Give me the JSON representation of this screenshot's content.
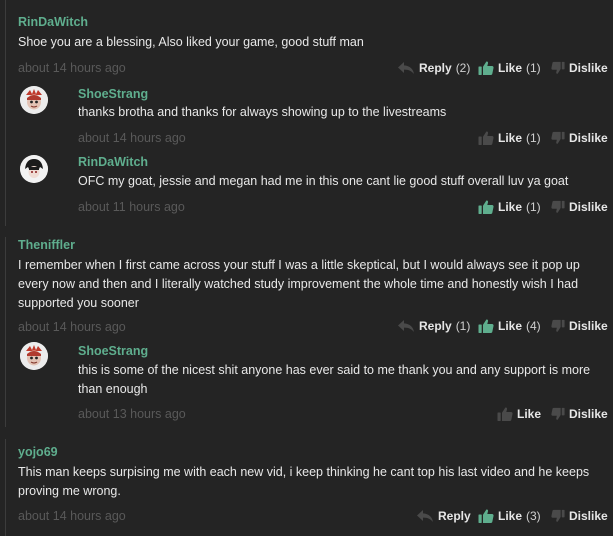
{
  "comments": [
    {
      "username": "RinDaWitch",
      "text": "Shoe you are a blessing, Also liked your game, good stuff man",
      "timestamp": "about 14 hours ago",
      "reply_label": "Reply",
      "reply_count": "(2)",
      "like_label": "Like",
      "like_count": "(1)",
      "dislike_label": "Dislike",
      "replies": [
        {
          "username": "ShoeStrang",
          "text": "thanks brotha and thanks for always showing up to the livestreams",
          "timestamp": "about 14 hours ago",
          "like_label": "Like",
          "like_count": "(1)",
          "dislike_label": "Dislike"
        },
        {
          "username": "RinDaWitch",
          "text": "OFC my goat, jessie and megan had me in this one cant lie good stuff overall luv ya goat",
          "timestamp": "about 11 hours ago",
          "like_label": "Like",
          "like_count": "(1)",
          "dislike_label": "Dislike"
        }
      ]
    },
    {
      "username": "Theniffler",
      "text": "I remember when I first came across your stuff I was a little skeptical, but I would always see it pop up every now and then and I literally watched study improvement the whole time and honestly wish I had supported you sooner",
      "timestamp": "about 14 hours ago",
      "reply_label": "Reply",
      "reply_count": "(1)",
      "like_label": "Like",
      "like_count": "(4)",
      "dislike_label": "Dislike",
      "replies": [
        {
          "username": "ShoeStrang",
          "text": "this is some of the nicest shit anyone has ever said to me thank you and any support is more than enough",
          "timestamp": "about 13 hours ago",
          "like_label": "Like",
          "dislike_label": "Dislike"
        }
      ]
    },
    {
      "username": "yojo69",
      "text": "This man keeps surpising me with each new vid, i keep thinking he cant top his last video and he keeps proving me wrong.",
      "timestamp": "about 14 hours ago",
      "reply_label": "Reply",
      "like_label": "Like",
      "like_count": "(3)",
      "dislike_label": "Dislike"
    }
  ],
  "icons": {
    "reply": "reply-arrow-icon",
    "like": "thumbs-up-icon",
    "dislike": "thumbs-down-icon"
  },
  "colors": {
    "background": "#242424",
    "username": "#5fae8e",
    "like_active": "#5fae8e",
    "muted": "#595959"
  }
}
